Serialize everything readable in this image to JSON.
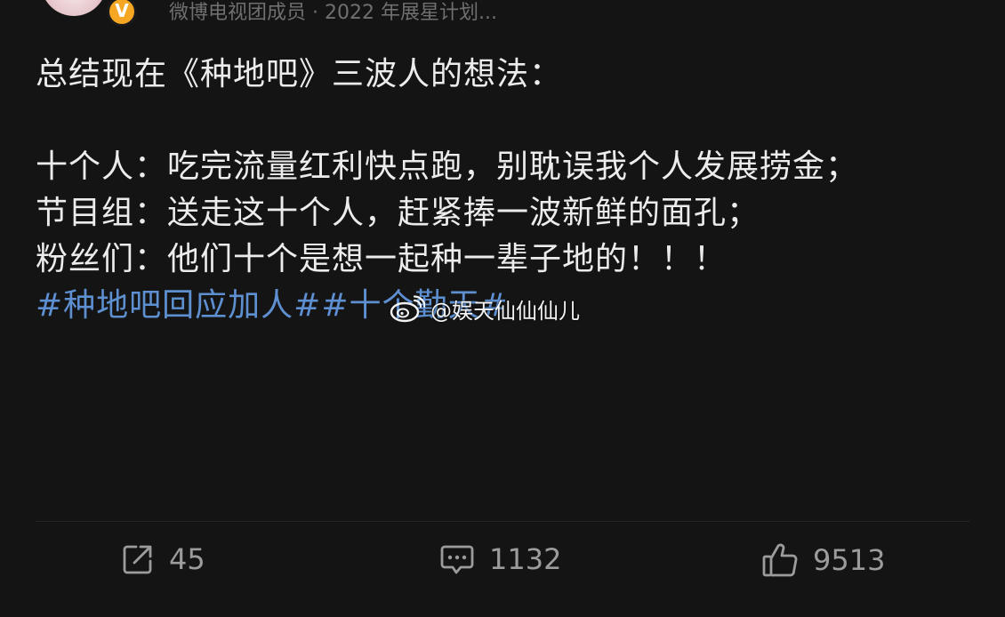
{
  "author": {
    "meta": "微博电视团成员 · 2022 年展星计划..."
  },
  "post": {
    "lines": [
      "总结现在《种地吧》三波人的想法：",
      "十个人：吃完流量红利快点跑，别耽误我个人发展捞金；",
      "节目组：送走这十个人，赶紧捧一波新鲜的面孔；",
      "粉丝们：他们十个是想一起种一辈子地的！！！"
    ],
    "hashtags": "#种地吧回应加人##十个勤天#"
  },
  "watermark": {
    "text": "@娱天仙仙仙儿"
  },
  "actions": {
    "forward_count": "45",
    "comment_count": "1132",
    "like_count": "9513"
  },
  "colors": {
    "background": "#141414",
    "text": "#ececec",
    "hashtag": "#5d8fd1",
    "action": "#9c9c9c",
    "verified": "#f5a623"
  }
}
